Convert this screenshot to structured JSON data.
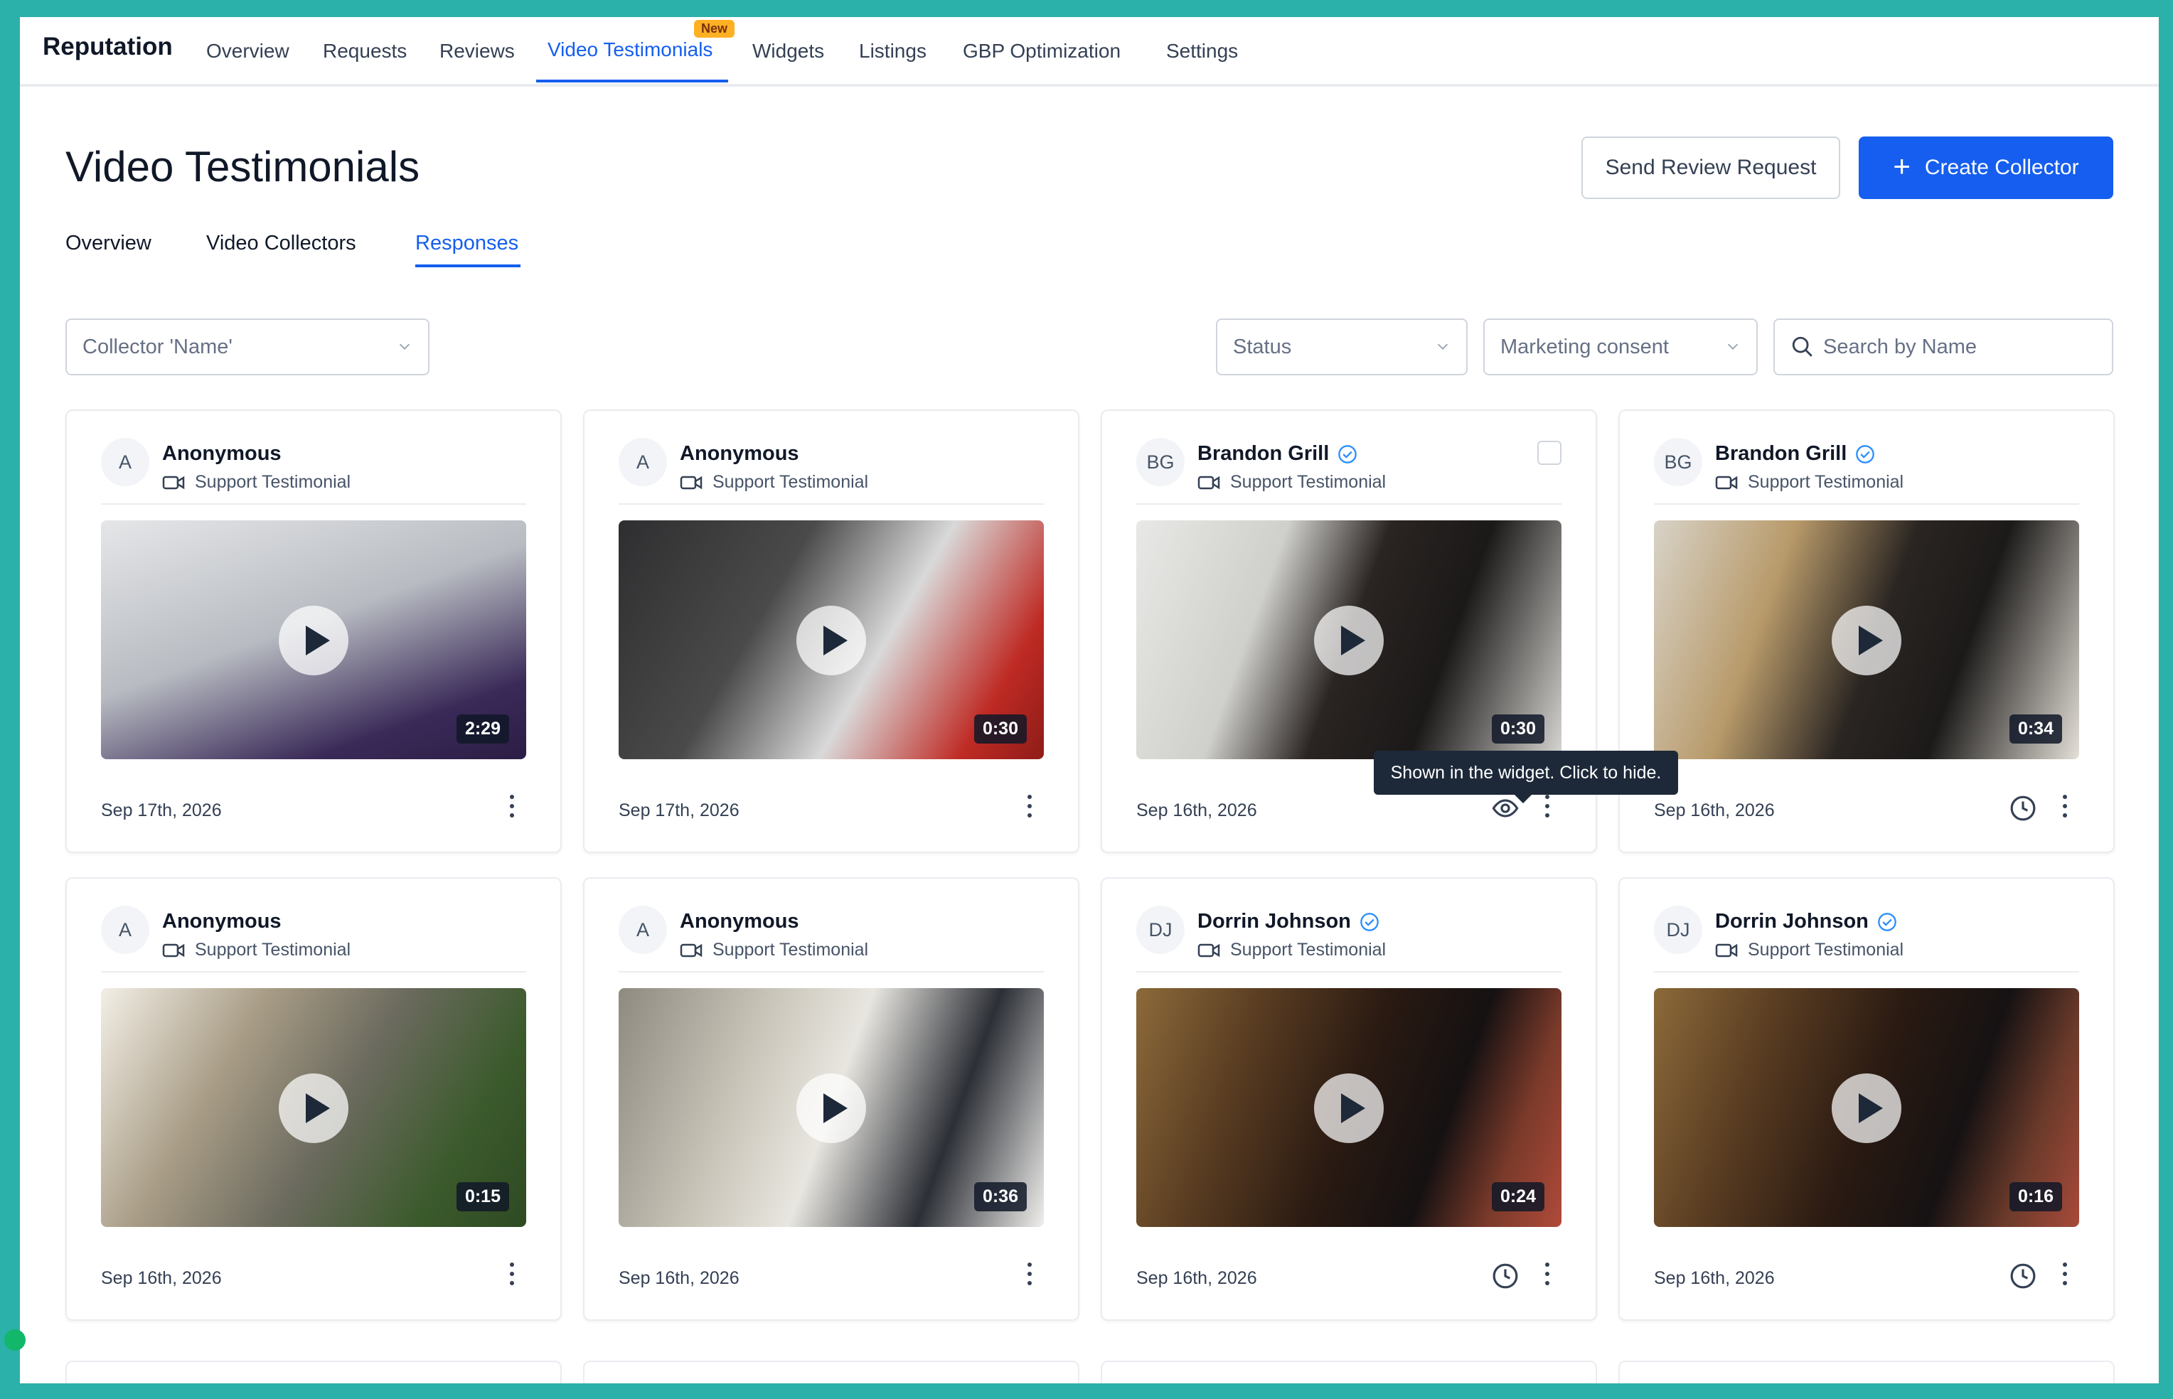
{
  "topnav": {
    "brand": "Reputation",
    "items": [
      {
        "label": "Overview"
      },
      {
        "label": "Requests"
      },
      {
        "label": "Reviews"
      },
      {
        "label": "Video Testimonials",
        "badge": "New"
      },
      {
        "label": "Widgets"
      },
      {
        "label": "Listings"
      },
      {
        "label": "GBP Optimization"
      },
      {
        "label": "Settings"
      }
    ]
  },
  "page": {
    "title": "Video Testimonials",
    "send_review_label": "Send Review Request",
    "create_collector_label": "Create Collector"
  },
  "subtabs": [
    {
      "label": "Overview"
    },
    {
      "label": "Video Collectors"
    },
    {
      "label": "Responses"
    }
  ],
  "filters": {
    "collector_placeholder": "Collector 'Name'",
    "status_placeholder": "Status",
    "consent_placeholder": "Marketing consent",
    "search_placeholder": "Search by Name"
  },
  "cards": [
    {
      "initials": "A",
      "name": "Anonymous",
      "type": "Support Testimonial",
      "duration": "2:29",
      "date": "Sep 17th, 2026",
      "status_icon": ""
    },
    {
      "initials": "A",
      "name": "Anonymous",
      "type": "Support Testimonial",
      "duration": "0:30",
      "date": "Sep 17th, 2026",
      "status_icon": ""
    },
    {
      "initials": "BG",
      "name": "Brandon Grill",
      "type": "Support Testimonial",
      "duration": "0:30",
      "date": "Sep 16th, 2026",
      "status_icon": "eye-icon"
    },
    {
      "initials": "BG",
      "name": "Brandon Grill",
      "type": "Support Testimonial",
      "duration": "0:34",
      "date": "Sep 16th, 2026",
      "status_icon": "clock-icon"
    },
    {
      "initials": "A",
      "name": "Anonymous",
      "type": "Support Testimonial",
      "duration": "0:15",
      "date": "Sep 16th, 2026",
      "status_icon": ""
    },
    {
      "initials": "A",
      "name": "Anonymous",
      "type": "Support Testimonial",
      "duration": "0:36",
      "date": "Sep 16th, 2026",
      "status_icon": ""
    },
    {
      "initials": "DJ",
      "name": "Dorrin Johnson",
      "type": "Support Testimonial",
      "duration": "0:24",
      "date": "Sep 16th, 2026",
      "status_icon": "clock-icon"
    },
    {
      "initials": "DJ",
      "name": "Dorrin Johnson",
      "type": "Support Testimonial",
      "duration": "0:16",
      "date": "Sep 16th, 2026",
      "status_icon": "clock-icon"
    }
  ],
  "tooltip": {
    "text": "Shown in the widget. Click to hide."
  },
  "colors": {
    "accent": "#155eef",
    "frame": "#2bb0aa",
    "badge": "#fdb022"
  }
}
